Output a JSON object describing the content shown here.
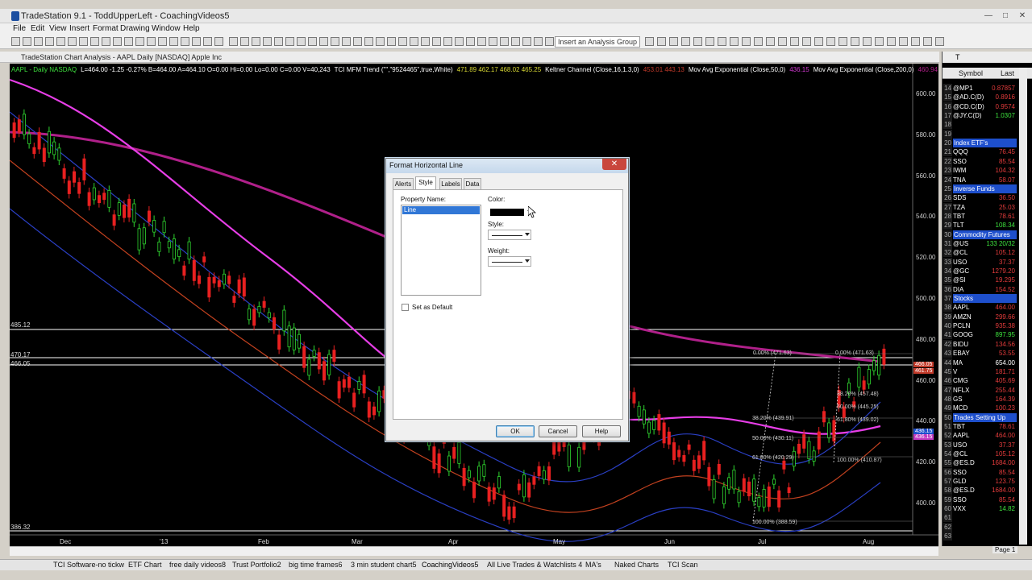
{
  "window": {
    "title": "TradeStation 9.1 - ToddUpperLeft - CoachingVideos5",
    "controls": [
      "—",
      "□",
      "✕"
    ]
  },
  "menu": [
    "File",
    "Edit",
    "View",
    "Insert",
    "Format",
    "Drawing",
    "Window",
    "Help"
  ],
  "toolbar": {
    "analysis_group_placeholder": "Insert an Analysis Group"
  },
  "chart_window": {
    "title": "TradeStation Chart Analysis - AAPL Daily [NASDAQ] Apple Inc",
    "status": [
      {
        "text": "AAPL - Daily  NASDAQ",
        "color": "#3ee23e"
      },
      {
        "text": "L=464.00  -1.25  -0.27%  B=464.00  A=464.10  O=0.00  Hi=0.00  Lo=0.00  C=0.00  V=40,243",
        "color": "#ffffff"
      },
      {
        "text": "TCI MFM Trend (\"\",\"9524465\",true,White)",
        "color": "#ffffff"
      },
      {
        "text": "471.89  462.17  468.02  465.25",
        "color": "#d9d934"
      },
      {
        "text": "Keltner Channel (Close,16,1.3,0)",
        "color": "#ffffff"
      },
      {
        "text": "453.01  443.13",
        "color": "#c23a2a"
      },
      {
        "text": "Mov Avg Exponential (Close,50,0)",
        "color": "#ffffff"
      },
      {
        "text": "436.15",
        "color": "#d63ad6"
      },
      {
        "text": "Mov Avg Exponential (Close,200,0)",
        "color": "#ffffff"
      },
      {
        "text": "460.94",
        "color": "#b0208a"
      }
    ],
    "price_axis": [
      "600.00",
      "580.00",
      "560.00",
      "540.00",
      "520.00",
      "500.00",
      "480.00",
      "460.00",
      "440.00",
      "420.00",
      "400.00"
    ],
    "date_axis": [
      "Dec",
      "'13",
      "Feb",
      "Mar",
      "Apr",
      "May",
      "Jun",
      "Jul",
      "Aug"
    ],
    "hlines": [
      "485.12",
      "470.17",
      "466.05",
      "386.32"
    ],
    "fib_labels": [
      "0.00% (471.63)",
      "0.00% (471.63)",
      "38.20% (439.91)",
      "50.00% (430.11)",
      "61.80% (420.29)",
      "100.00% (388.59)",
      "38.20% (457.48)",
      "50.00% (445.25)",
      "61.80% (439.02)",
      "100.00% (410.87)"
    ],
    "axis_tags": [
      "466.05",
      "461.75",
      "436.15",
      "436.15"
    ]
  },
  "dialog": {
    "title": "Format Horizontal Line",
    "close": "✕",
    "tabs": [
      "Alerts",
      "Style",
      "Labels",
      "Data"
    ],
    "active_tab": "Style",
    "property_name_label": "Property Name:",
    "property_selected": "Line",
    "color_label": "Color:",
    "color_value": "#000000",
    "style_label": "Style:",
    "weight_label": "Weight:",
    "set_default_label": "Set as Default",
    "buttons": {
      "ok": "OK",
      "cancel": "Cancel",
      "help": "Help"
    }
  },
  "right_panel": {
    "header": "T",
    "columns": {
      "symbol": "Symbol",
      "last": "Last"
    },
    "rows": [
      {
        "n": "14",
        "s": "@MP1",
        "l": "0.87857",
        "color": "#e23b3b"
      },
      {
        "n": "15",
        "s": "@AD.C(D)",
        "l": "0.8916",
        "color": "#e23b3b"
      },
      {
        "n": "16",
        "s": "@CD.C(D)",
        "l": "0.9574",
        "color": "#e23b3b"
      },
      {
        "n": "17",
        "s": "@JY.C(D)",
        "l": "1.0307",
        "color": "#3ee23e"
      },
      {
        "n": "18",
        "s": "",
        "l": ""
      },
      {
        "n": "19",
        "s": "",
        "l": ""
      },
      {
        "n": "20",
        "s": "Index ETF's",
        "sect": true
      },
      {
        "n": "21",
        "s": "QQQ",
        "l": "76.45",
        "color": "#e23b3b"
      },
      {
        "n": "22",
        "s": "SSO",
        "l": "85.54",
        "color": "#e23b3b"
      },
      {
        "n": "23",
        "s": "IWM",
        "l": "104.32",
        "color": "#e23b3b"
      },
      {
        "n": "24",
        "s": "TNA",
        "l": "58.07",
        "color": "#e23b3b"
      },
      {
        "n": "25",
        "s": "Inverse Funds",
        "sect": true
      },
      {
        "n": "26",
        "s": "SDS",
        "l": "36.50",
        "color": "#e23b3b"
      },
      {
        "n": "27",
        "s": "TZA",
        "l": "25.03",
        "color": "#e23b3b"
      },
      {
        "n": "28",
        "s": "TBT",
        "l": "78.61",
        "color": "#e23b3b"
      },
      {
        "n": "29",
        "s": "TLT",
        "l": "108.34",
        "color": "#3ee23e"
      },
      {
        "n": "30",
        "s": "Commodity Futures",
        "sect": true
      },
      {
        "n": "31",
        "s": "@US",
        "l": "133 20/32",
        "color": "#3ee23e"
      },
      {
        "n": "32",
        "s": "@CL",
        "l": "105.12",
        "color": "#e23b3b"
      },
      {
        "n": "33",
        "s": "USO",
        "l": "37.37",
        "color": "#e23b3b"
      },
      {
        "n": "34",
        "s": "@GC",
        "l": "1279.20",
        "color": "#e23b3b"
      },
      {
        "n": "35",
        "s": "@SI",
        "l": "19.295",
        "color": "#e23b3b"
      },
      {
        "n": "36",
        "s": "DIA",
        "l": "154.52",
        "color": "#e23b3b"
      },
      {
        "n": "37",
        "s": "Stocks",
        "sect": true
      },
      {
        "n": "38",
        "s": "AAPL",
        "l": "464.00",
        "color": "#e23b3b"
      },
      {
        "n": "39",
        "s": "AMZN",
        "l": "299.66",
        "color": "#e23b3b"
      },
      {
        "n": "40",
        "s": "PCLN",
        "l": "935.38",
        "color": "#e23b3b"
      },
      {
        "n": "41",
        "s": "GOOG",
        "l": "897.95",
        "color": "#3ee23e"
      },
      {
        "n": "42",
        "s": "BIDU",
        "l": "134.56",
        "color": "#e23b3b"
      },
      {
        "n": "43",
        "s": "EBAY",
        "l": "53.55",
        "color": "#e23b3b"
      },
      {
        "n": "44",
        "s": "MA",
        "l": "654.00",
        "color": "#ffffff"
      },
      {
        "n": "45",
        "s": "V",
        "l": "181.71",
        "color": "#e23b3b"
      },
      {
        "n": "46",
        "s": "CMG",
        "l": "405.69",
        "color": "#e23b3b"
      },
      {
        "n": "47",
        "s": "NFLX",
        "l": "255.44",
        "color": "#e23b3b"
      },
      {
        "n": "48",
        "s": "GS",
        "l": "164.39",
        "color": "#e23b3b"
      },
      {
        "n": "49",
        "s": "MCD",
        "l": "100.23",
        "color": "#e23b3b"
      },
      {
        "n": "50",
        "s": "Trades Setting Up",
        "sect": true
      },
      {
        "n": "51",
        "s": "TBT",
        "l": "78.61",
        "color": "#e23b3b"
      },
      {
        "n": "52",
        "s": "AAPL",
        "l": "464.00",
        "color": "#e23b3b"
      },
      {
        "n": "53",
        "s": "USO",
        "l": "37.37",
        "color": "#e23b3b"
      },
      {
        "n": "54",
        "s": "@CL",
        "l": "105.12",
        "color": "#e23b3b"
      },
      {
        "n": "55",
        "s": "@ES.D",
        "l": "1684.00",
        "color": "#e23b3b"
      },
      {
        "n": "56",
        "s": "SSO",
        "l": "85.54",
        "color": "#e23b3b"
      },
      {
        "n": "57",
        "s": "GLD",
        "l": "123.75",
        "color": "#e23b3b"
      },
      {
        "n": "58",
        "s": "@ES.D",
        "l": "1684.00",
        "color": "#e23b3b"
      },
      {
        "n": "59",
        "s": "SSO",
        "l": "85.54",
        "color": "#e23b3b"
      },
      {
        "n": "60",
        "s": "VXX",
        "l": "14.82",
        "color": "#3ee23e"
      },
      {
        "n": "61",
        "s": "",
        "l": ""
      },
      {
        "n": "62",
        "s": "",
        "l": ""
      },
      {
        "n": "63",
        "s": "",
        "l": ""
      }
    ],
    "page_tab": "Page 1"
  },
  "workspace_tabs": [
    "TCI Software-no tickw",
    "ETF Chart",
    "free daily videos8",
    "Trust Portfolio2",
    "big time frames6",
    "3 min student chart5",
    "CoachingVideos5",
    "All Live Trades & Watchlists 4",
    "MA's",
    "Naked Charts",
    "TCI Scan"
  ],
  "active_workspace": "CoachingVideos5"
}
